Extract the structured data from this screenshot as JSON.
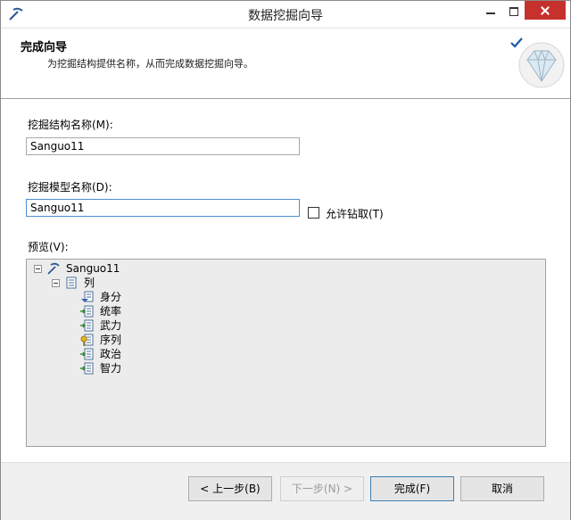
{
  "window": {
    "title": "数据挖掘向导"
  },
  "header": {
    "title": "完成向导",
    "description": "为挖掘结构提供名称，从而完成数据挖掘向导。"
  },
  "form": {
    "structure_name_label": "挖掘结构名称(M):",
    "structure_name_value": "Sanguo11",
    "model_name_label": "挖掘模型名称(D):",
    "model_name_value": "Sanguo11",
    "allow_drillthrough_label": "允许钻取(T)",
    "allow_drillthrough_checked": false,
    "preview_label": "预览(V):"
  },
  "preview_tree": {
    "root": "Sanguo11",
    "columns_node": "列",
    "columns": [
      "身分",
      "统率",
      "武力",
      "序列",
      "政治",
      "智力"
    ]
  },
  "buttons": {
    "back": "< 上一步(B)",
    "next": "下一步(N) >",
    "finish": "完成(F)",
    "cancel": "取消"
  },
  "colors": {
    "close_button": "#c7312b",
    "focus_border": "#4a90d0",
    "preview_bg": "#ececec",
    "footer_bg": "#f0f0f0"
  }
}
